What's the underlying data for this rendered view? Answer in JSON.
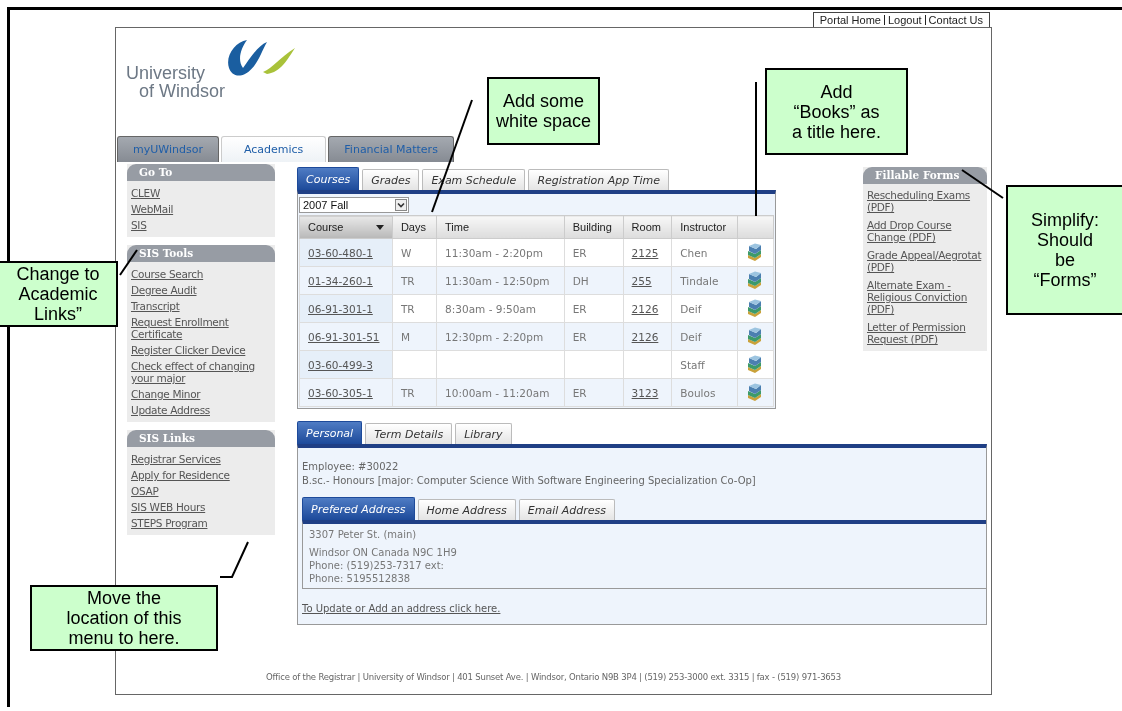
{
  "portal_links": [
    "Portal Home",
    "Logout",
    "Contact Us"
  ],
  "logo": {
    "line1": "University",
    "line2": "of Windsor"
  },
  "main_tabs": [
    {
      "label": "myUWindsor",
      "selected": false
    },
    {
      "label": "Academics",
      "selected": true
    },
    {
      "label": "Financial Matters",
      "selected": false
    }
  ],
  "sidebar": [
    {
      "title": "Go To",
      "items": [
        "CLEW",
        "WebMail",
        "SIS"
      ]
    },
    {
      "title": "SIS Tools",
      "items": [
        "Course Search",
        "Degree Audit",
        "Transcript",
        "Request Enrollment Certificate",
        "Register Clicker Device",
        "Check effect of changing your major",
        "Change Minor",
        "Update Address"
      ]
    },
    {
      "title": "SIS Links",
      "items": [
        "Registrar Services",
        "Apply for Residence",
        "OSAP",
        "SIS WEB Hours",
        "STEPS Program"
      ]
    }
  ],
  "course_tabs": [
    {
      "label": "Courses",
      "selected": true
    },
    {
      "label": "Grades",
      "selected": false
    },
    {
      "label": "Exam Schedule",
      "selected": false
    },
    {
      "label": "Registration App Time",
      "selected": false
    }
  ],
  "term_select": {
    "value": "2007 Fall"
  },
  "table": {
    "columns": [
      "Course",
      "Days",
      "Time",
      "Building",
      "Room",
      "Instructor"
    ],
    "rows": [
      {
        "course": "03-60-480-1",
        "days": "W",
        "time": "11:30am - 2:20pm",
        "building": "ER",
        "room": "2125",
        "instructor": "Chen"
      },
      {
        "course": "01-34-260-1",
        "days": "TR",
        "time": "11:30am - 12:50pm",
        "building": "DH",
        "room": "255",
        "instructor": "Tindale"
      },
      {
        "course": "06-91-301-1",
        "days": "TR",
        "time": "8:30am - 9:50am",
        "building": "ER",
        "room": "2126",
        "instructor": "Deif"
      },
      {
        "course": "06-91-301-51",
        "days": "M",
        "time": "12:30pm - 2:20pm",
        "building": "ER",
        "room": "2126",
        "instructor": "Deif"
      },
      {
        "course": "03-60-499-3",
        "instructor": "Staff"
      },
      {
        "course": "03-60-305-1",
        "days": "TR",
        "time": "10:00am - 11:20am",
        "building": "ER",
        "room": "3123",
        "instructor": "Boulos"
      }
    ]
  },
  "fillable_forms": {
    "title": "Fillable Forms",
    "items": [
      "Rescheduling Exams (PDF)",
      "Add Drop Course Change (PDF)",
      "Grade Appeal/Aegrotat (PDF)",
      "Alternate Exam - Religious Conviction (PDF)",
      "Letter of Permission Request (PDF)"
    ]
  },
  "personal_tabs": [
    {
      "label": "Personal",
      "selected": true
    },
    {
      "label": "Term Details",
      "selected": false
    },
    {
      "label": "Library",
      "selected": false
    }
  ],
  "personal": {
    "employee": "Employee: #30022",
    "program": "B.sc.- Honours [major: Computer Science With Software Engineering Specialization Co-Op]"
  },
  "address_tabs": [
    {
      "label": "Prefered Address",
      "selected": true
    },
    {
      "label": "Home Address",
      "selected": false
    },
    {
      "label": "Email Address",
      "selected": false
    }
  ],
  "address_lines": [
    "3307 Peter St. (main)",
    "Windsor ON Canada N9C 1H9",
    "Phone: (519)253-7317 ext:",
    "Phone: 5195512838"
  ],
  "update_link": "To Update or Add an address click here.",
  "footer": "Office of the Registrar | University of Windsor | 401 Sunset Ave. | Windsor, Ontario N9B 3P4 | (519) 253-3000 ext. 3315 | fax - (519) 971-3653",
  "callouts": [
    {
      "lines": [
        "Add some",
        "white space"
      ]
    },
    {
      "lines": [
        "Add",
        "“Books” as",
        "a title here."
      ]
    },
    {
      "lines": [
        "Simplify:",
        "Should",
        "be",
        "“Forms”"
      ]
    },
    {
      "lines": [
        "Change to",
        "Academic",
        "Links”"
      ]
    },
    {
      "lines": [
        "Move the",
        "location of this",
        "menu to here."
      ]
    }
  ]
}
